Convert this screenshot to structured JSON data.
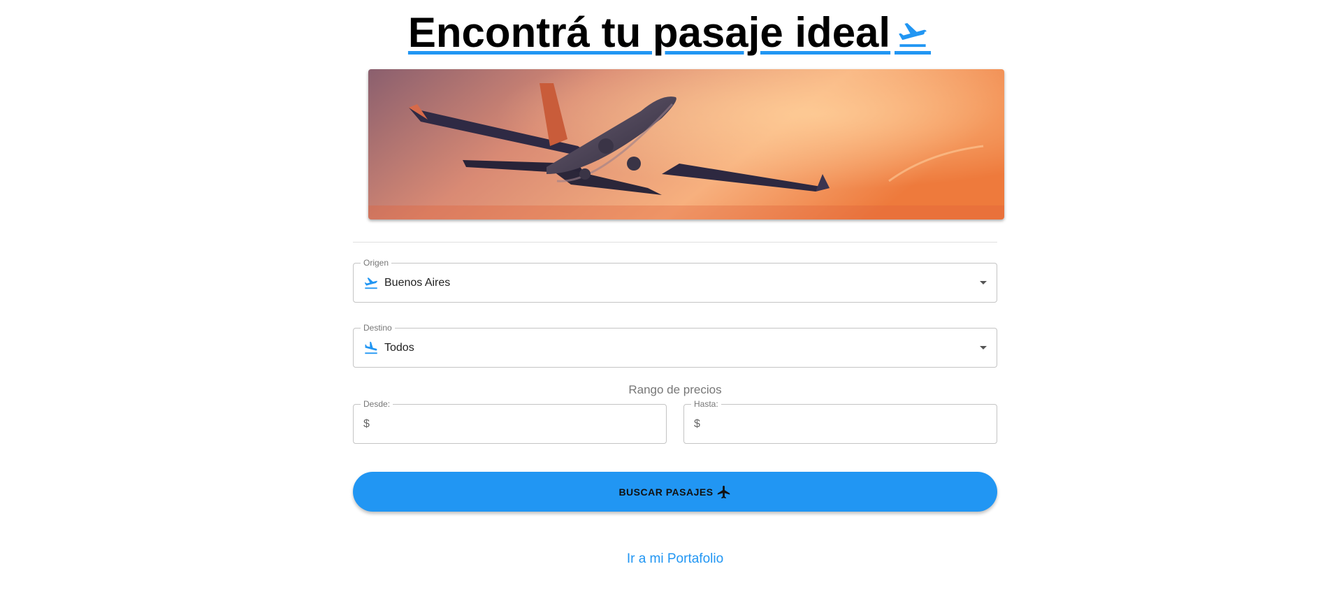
{
  "header": {
    "title": "Encontrá tu pasaje ideal",
    "icon": "flight-takeoff-icon"
  },
  "hero": {
    "image": "airplane-sunset-banner"
  },
  "form": {
    "origin": {
      "label": "Origen",
      "value": "Buenos Aires",
      "icon": "flight-takeoff-icon"
    },
    "destination": {
      "label": "Destino",
      "value": "Todos",
      "icon": "flight-land-icon"
    },
    "price_range": {
      "title": "Rango de precios",
      "from": {
        "label": "Desde:",
        "prefix": "$",
        "value": ""
      },
      "to": {
        "label": "Hasta:",
        "prefix": "$",
        "value": ""
      }
    },
    "search_button": {
      "label": "BUSCAR PASAJES",
      "icon": "airplane-icon"
    }
  },
  "footer": {
    "portfolio_link": "Ir a mi Portafolio"
  },
  "colors": {
    "accent": "#2196f3",
    "border": "#c4c4c4",
    "muted": "#777777"
  }
}
